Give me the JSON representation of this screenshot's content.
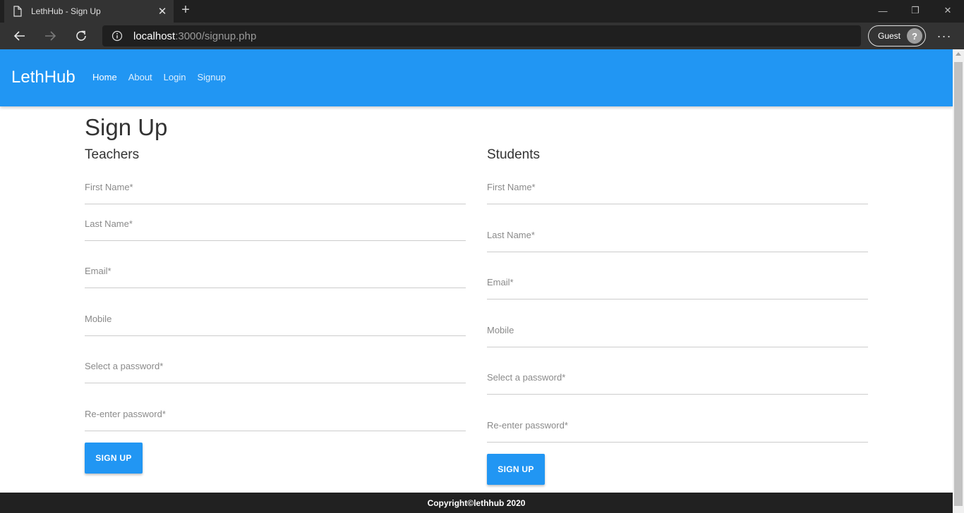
{
  "browser": {
    "tab_title": "LethHub - Sign Up",
    "tab_close": "✕",
    "new_tab": "+",
    "url_host": "localhost",
    "url_rest": ":3000/signup.php",
    "profile_label": "Guest",
    "profile_icon": "?",
    "menu": "···",
    "minimize": "—",
    "restore": "❐",
    "close": "✕"
  },
  "navbar": {
    "brand": "LethHub",
    "links": [
      "Home",
      "About",
      "Login",
      "Signup"
    ]
  },
  "page": {
    "title": "Sign Up"
  },
  "teachers": {
    "title": "Teachers",
    "first_name": "First Name*",
    "last_name": "Last Name*",
    "email": "Email*",
    "mobile": "Mobile",
    "password": "Select a password*",
    "reenter_password": "Re-enter password*",
    "submit": "SIGN UP"
  },
  "students": {
    "title": "Students",
    "first_name": "First Name*",
    "last_name": "Last Name*",
    "email": "Email*",
    "mobile": "Mobile",
    "password": "Select a password*",
    "reenter_password": "Re-enter password*",
    "submit": "SIGN UP"
  },
  "footer": {
    "copyright": "Copyright©lethhub 2020"
  },
  "colors": {
    "primary": "#2196f3",
    "footer_bg": "#212121",
    "chrome_bg": "#202020",
    "toolbar_bg": "#333333"
  }
}
